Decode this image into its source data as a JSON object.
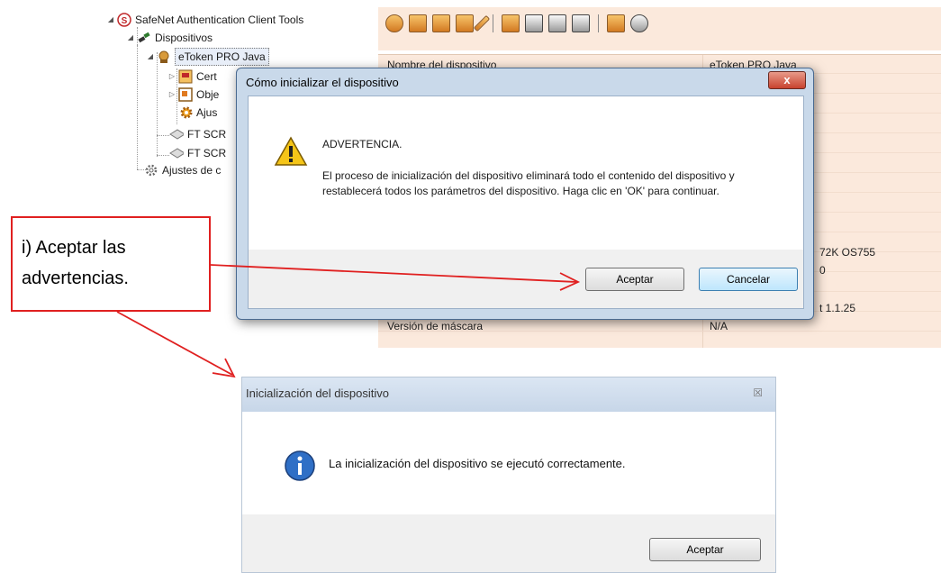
{
  "tree": {
    "root": "SafeNet Authentication Client Tools",
    "devices": "Dispositivos",
    "token": "eToken PRO Java",
    "child_cert": "Cert",
    "child_obj": "Obje",
    "child_adj": "Ajus",
    "reader1": "FT SCR",
    "reader2": "FT SCR",
    "settings": "Ajustes de c"
  },
  "panel": {
    "rows": [
      {
        "label": "Nombre del dispositivo",
        "value": "eToken PRO Java"
      },
      {
        "label": "",
        "value": "72K OS755"
      },
      {
        "label": "",
        "value": "0"
      },
      {
        "label": "",
        "value": "t 1.1.25"
      },
      {
        "label": "Versión de máscara",
        "value": "N/A"
      }
    ]
  },
  "dialog": {
    "title": "Cómo inicializar el dispositivo",
    "close_label": "x",
    "heading": "ADVERTENCIA.",
    "message": "El proceso de inicialización del dispositivo eliminará todo el contenido del dispositivo y restablecerá todos los parámetros del dispositivo. Haga clic en 'OK' para continuar.",
    "accept_label": "Aceptar",
    "cancel_label": "Cancelar"
  },
  "annotation": {
    "line1": "i) Aceptar las",
    "line2": "advertencias."
  },
  "dialog2": {
    "title": "Inicialización del dispositivo",
    "close_label": "☒",
    "message": "La inicialización del dispositivo se ejecutó correctamente.",
    "accept_label": "Aceptar"
  },
  "colors": {
    "panel_bg": "#fbe9dc",
    "annotation_red": "#e02020"
  }
}
